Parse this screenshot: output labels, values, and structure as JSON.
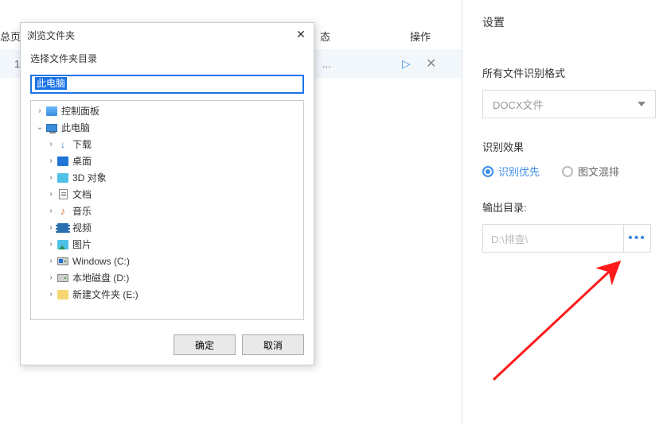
{
  "header": {
    "page": "总页",
    "status": "态",
    "action": "操作"
  },
  "row": {
    "index": "1",
    "status_suffix": "...",
    "play_glyph": "▷",
    "close_glyph": "✕"
  },
  "settings": {
    "title": "设置",
    "format_label": "所有文件识别格式",
    "format_value": "DOCX文件",
    "effect_label": "识别效果",
    "effect_options": {
      "priority": "识别优先",
      "mixed": "图文混排"
    },
    "effect_selected": "priority",
    "output_label": "输出目录:",
    "output_value": "D:\\排查\\",
    "browse_glyph": "•••"
  },
  "dialog": {
    "title": "浏览文件夹",
    "subtitle": "选择文件夹目录",
    "input_value": "此电脑",
    "ok": "确定",
    "cancel": "取消",
    "tree": [
      {
        "level": 1,
        "expander": "›",
        "icon": "ctrl",
        "label": "控制面板"
      },
      {
        "level": 1,
        "expander": "⌄",
        "icon": "pc",
        "label": "此电脑"
      },
      {
        "level": 2,
        "expander": "›",
        "icon": "dl",
        "label": "下载"
      },
      {
        "level": 2,
        "expander": "›",
        "icon": "desk",
        "label": "桌面"
      },
      {
        "level": 2,
        "expander": "›",
        "icon": "3d",
        "label": "3D 对象"
      },
      {
        "level": 2,
        "expander": "›",
        "icon": "doc",
        "label": "文档"
      },
      {
        "level": 2,
        "expander": "›",
        "icon": "music",
        "label": "音乐"
      },
      {
        "level": 2,
        "expander": "›",
        "icon": "video",
        "label": "视频"
      },
      {
        "level": 2,
        "expander": "›",
        "icon": "pic",
        "label": "图片"
      },
      {
        "level": 2,
        "expander": "›",
        "icon": "drive-win",
        "label": "Windows (C:)"
      },
      {
        "level": 2,
        "expander": "›",
        "icon": "drive",
        "label": "本地磁盘 (D:)"
      },
      {
        "level": 2,
        "expander": "›",
        "icon": "folder",
        "label": "新建文件夹 (E:)"
      }
    ]
  }
}
